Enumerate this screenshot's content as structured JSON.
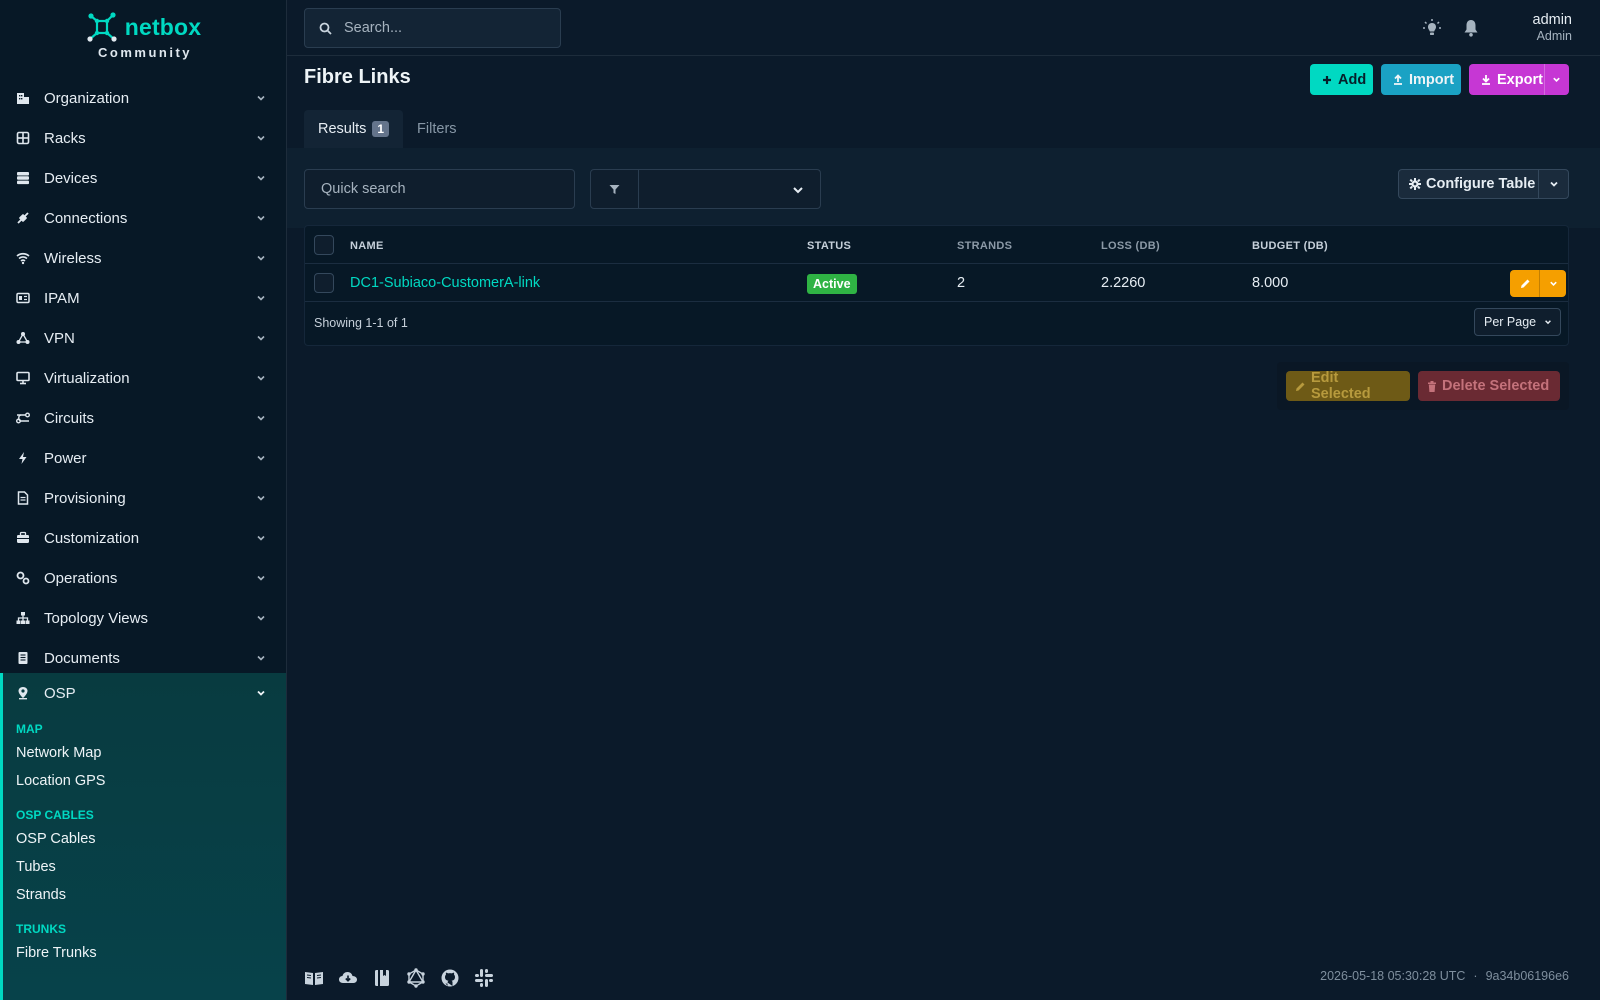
{
  "brand": {
    "name": "netbox",
    "edition": "Community",
    "accent": "#00d9c2"
  },
  "search": {
    "placeholder": "Search..."
  },
  "user": {
    "name": "admin",
    "role": "Admin"
  },
  "sidebar": {
    "items": [
      {
        "label": "Organization",
        "icon": "building-icon"
      },
      {
        "label": "Racks",
        "icon": "rack-icon"
      },
      {
        "label": "Devices",
        "icon": "server-icon"
      },
      {
        "label": "Connections",
        "icon": "cable-icon"
      },
      {
        "label": "Wireless",
        "icon": "wifi-icon"
      },
      {
        "label": "IPAM",
        "icon": "ip-icon"
      },
      {
        "label": "VPN",
        "icon": "vpn-icon"
      },
      {
        "label": "Virtualization",
        "icon": "monitor-icon"
      },
      {
        "label": "Circuits",
        "icon": "circuit-icon"
      },
      {
        "label": "Power",
        "icon": "lightning-icon"
      },
      {
        "label": "Provisioning",
        "icon": "file-icon"
      },
      {
        "label": "Customization",
        "icon": "toolbox-icon"
      },
      {
        "label": "Operations",
        "icon": "cogs-icon"
      },
      {
        "label": "Topology Views",
        "icon": "sitemap-icon"
      },
      {
        "label": "Documents",
        "icon": "document-icon"
      }
    ],
    "osp": {
      "label": "OSP",
      "icon": "map-marker-icon",
      "groups": [
        {
          "heading": "MAP",
          "links": [
            "Network Map",
            "Location GPS"
          ]
        },
        {
          "heading": "OSP CABLES",
          "links": [
            "OSP Cables",
            "Tubes",
            "Strands"
          ]
        },
        {
          "heading": "TRUNKS",
          "links": [
            "Fibre Trunks"
          ]
        }
      ]
    }
  },
  "page": {
    "title": "Fibre Links",
    "buttons": {
      "add": "Add",
      "import": "Import",
      "export": "Export"
    },
    "tabs": {
      "results": "Results",
      "results_count": "1",
      "filters": "Filters"
    }
  },
  "toolbar": {
    "quick_search_placeholder": "Quick search",
    "configure_table": "Configure Table"
  },
  "table": {
    "columns": [
      "NAME",
      "STATUS",
      "STRANDS",
      "LOSS (DB)",
      "BUDGET (DB)"
    ],
    "rows": [
      {
        "name": "DC1-Subiaco-CustomerA-link",
        "status": "Active",
        "strands": "2",
        "loss": "2.2260",
        "budget": "8.000"
      }
    ],
    "showing": "Showing 1-1 of 1",
    "per_page": "Per Page"
  },
  "bulk": {
    "edit": "Edit Selected",
    "delete": "Delete Selected"
  },
  "footer": {
    "icons": [
      "docs-book-icon",
      "cloud-api-icon",
      "api-book-icon",
      "graphql-icon",
      "github-icon",
      "slack-icon"
    ],
    "timestamp": "2026-05-18 05:30:28 UTC",
    "separator": "·",
    "version": "9a34b06196e6"
  },
  "colors": {
    "background": "#0b1a2a",
    "sidebar": "#071826",
    "accent": "#00d9c2",
    "add": "#00d9c2",
    "import": "#1aa2c4",
    "export": "#c637d4",
    "active_status": "#2fb344",
    "edit": "#f59f00",
    "delete_muted": "#6a2a33"
  }
}
